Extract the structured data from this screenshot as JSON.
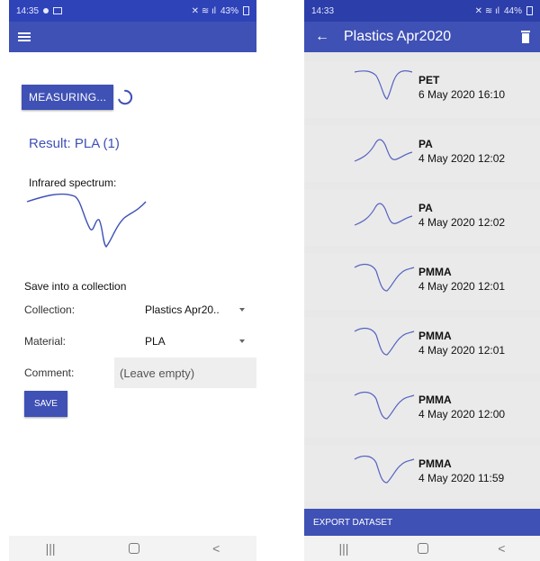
{
  "left": {
    "status": {
      "time": "14:35",
      "battery": "43%"
    },
    "measure_button": "MEASURING...",
    "result": "Result: PLA (1)",
    "spectrum_label": "Infrared spectrum:",
    "save_header": "Save into a collection",
    "collection_label": "Collection:",
    "collection_value": "Plastics Apr20..",
    "material_label": "Material:",
    "material_value": "PLA",
    "comment_label": "Comment:",
    "comment_placeholder": "(Leave empty)",
    "save_button": "SAVE",
    "nav": {
      "recents": "|||",
      "back": "<"
    }
  },
  "right": {
    "status": {
      "time": "14:33",
      "battery": "44%"
    },
    "title": "Plastics Apr2020",
    "items": [
      {
        "name": "PET",
        "date": "6 May 2020 16:10"
      },
      {
        "name": "PA",
        "date": "4 May 2020 12:02"
      },
      {
        "name": "PA",
        "date": "4 May 2020 12:02"
      },
      {
        "name": "PMMA",
        "date": "4 May 2020 12:01"
      },
      {
        "name": "PMMA",
        "date": "4 May 2020 12:01"
      },
      {
        "name": "PMMA",
        "date": "4 May 2020 12:00"
      },
      {
        "name": "PMMA",
        "date": "4 May 2020 11:59"
      }
    ],
    "export_button": "EXPORT DATASET",
    "nav": {
      "recents": "|||",
      "back": "<"
    }
  },
  "icons": {
    "menu": "hamburger-menu-icon",
    "back": "arrow-back-icon",
    "delete": "trash-icon",
    "spinner": "loading-spinner-icon",
    "home": "nav-home-icon"
  },
  "colors": {
    "primary": "#3f51b5",
    "status_bar": "#2f43b8",
    "card_bg": "#eaeaea",
    "spectrum_line": "#3f51b5"
  }
}
